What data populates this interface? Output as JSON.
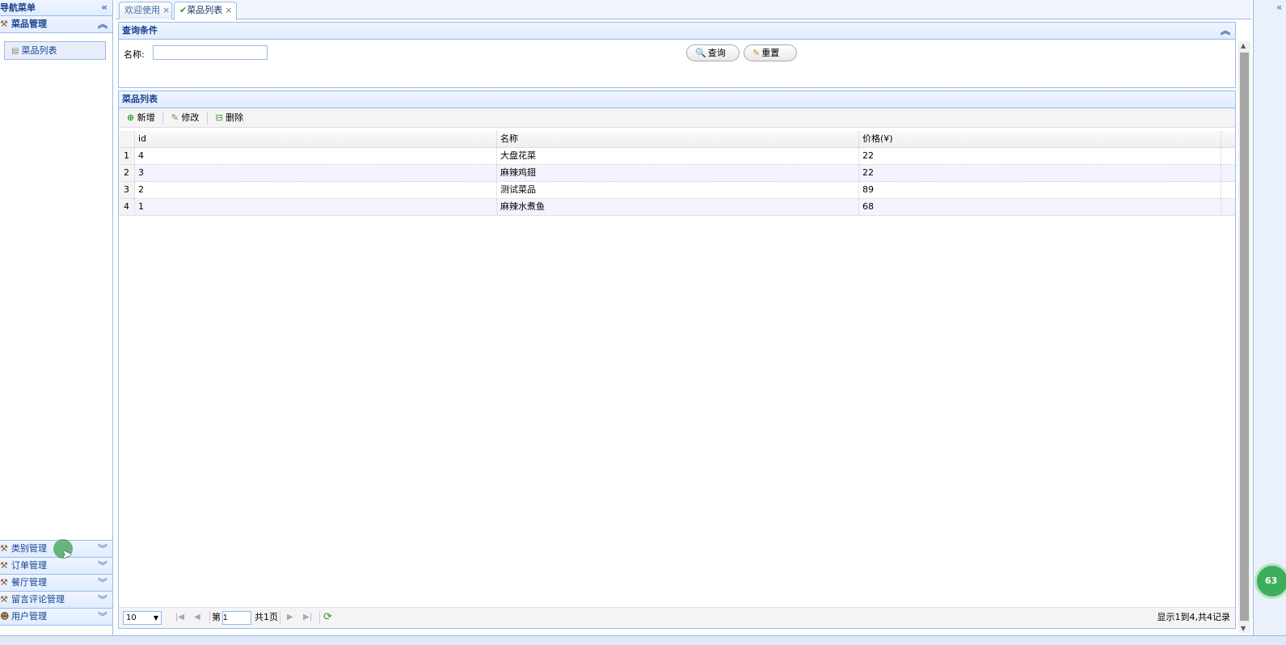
{
  "nav": {
    "title": "导航菜单",
    "collapse_icon": "«",
    "sections": [
      {
        "label": "菜品管理",
        "expanded": true,
        "items": [
          {
            "label": "菜品列表"
          }
        ]
      },
      {
        "label": "类别管理",
        "expanded": false
      },
      {
        "label": "订单管理",
        "expanded": false
      },
      {
        "label": "餐厅管理",
        "expanded": false
      },
      {
        "label": "留言评论管理",
        "expanded": false
      },
      {
        "label": "用户管理",
        "expanded": false
      }
    ]
  },
  "tabs": [
    {
      "label": "欢迎使用",
      "close": "×"
    },
    {
      "label": "菜品列表",
      "close": "×",
      "active": true
    }
  ],
  "query": {
    "title": "查询条件",
    "name_label": "名称:",
    "name_value": "",
    "search_label": "查询",
    "reset_label": "重置"
  },
  "list": {
    "title": "菜品列表",
    "toolbar": {
      "add": "新增",
      "edit": "修改",
      "delete": "删除"
    },
    "columns": [
      "id",
      "名称",
      "价格(¥)"
    ],
    "rows": [
      {
        "rn": "1",
        "id": "4",
        "name": "大盘花菜",
        "price": "22"
      },
      {
        "rn": "2",
        "id": "3",
        "name": "麻辣鸡翅",
        "price": "22"
      },
      {
        "rn": "3",
        "id": "2",
        "name": "测试菜品",
        "price": "89"
      },
      {
        "rn": "4",
        "id": "1",
        "name": "麻辣水煮鱼",
        "price": "68"
      }
    ],
    "pager": {
      "page_size": "10",
      "page_prefix": "第",
      "page_value": "1",
      "page_total": "共1页",
      "info": "显示1到4,共4记录"
    }
  },
  "badge": "63",
  "colors": {
    "border": "#99bbe8",
    "header_text": "#15428b",
    "row_alt": "#f3f3ff"
  }
}
